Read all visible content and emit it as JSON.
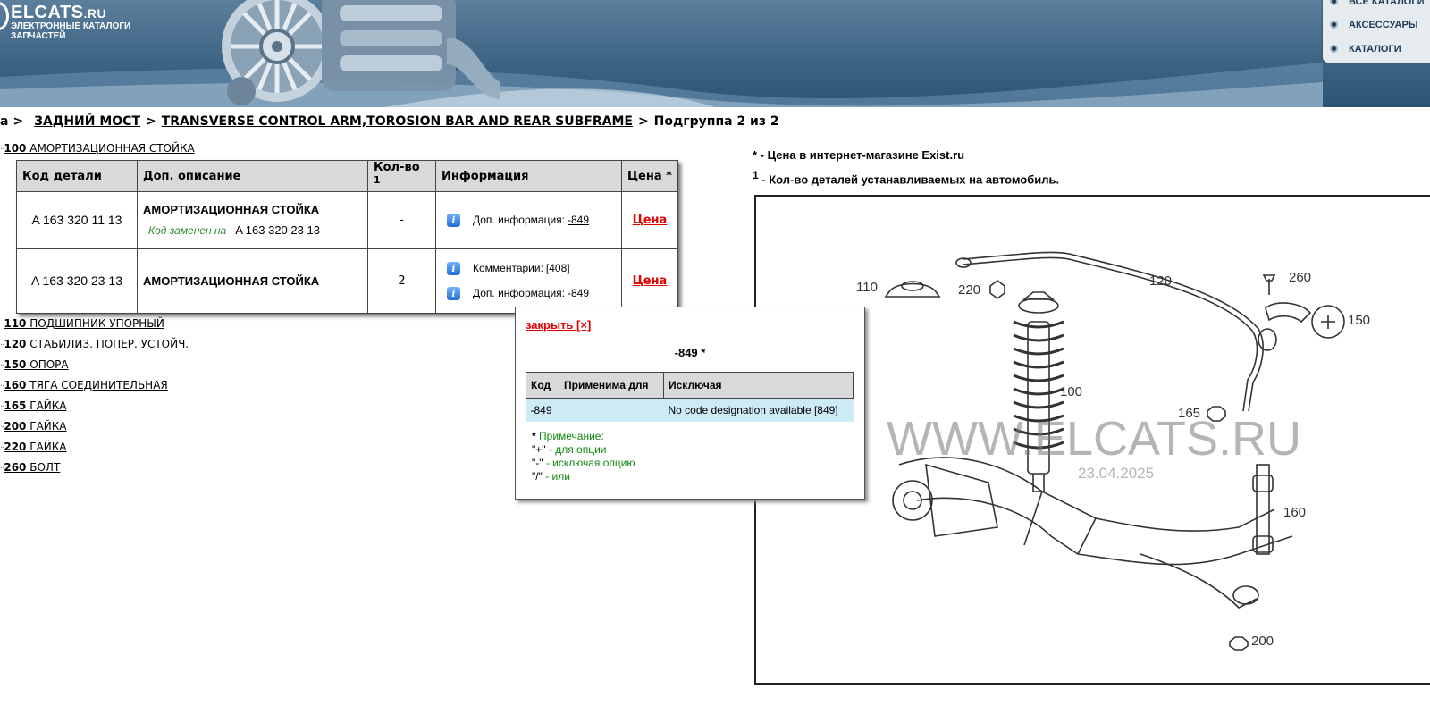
{
  "header": {
    "logo_title": "ELCATS",
    "logo_suffix": ".RU",
    "logo_subtitle": "ЭЛЕКТРОННЫЕ КАТАЛОГИ ЗАПЧАСТЕЙ",
    "top_nav": [
      "ВСЕ КАТАЛОГИ",
      "АКСЕССУАРЫ",
      "КАТАЛОГИ"
    ]
  },
  "breadcrumb": {
    "prefix": "a >",
    "items": [
      "ЗАДНИЙ МОСТ",
      "TRANSVERSE CONTROL ARM,TOROSION BAR AND REAR SUBFRAME"
    ],
    "current": "Подгруппа 2 из 2"
  },
  "subgroups": [
    {
      "num": "100",
      "name": "АМОРТИЗАЦИОННАЯ СТОЙКА"
    },
    {
      "num": "110",
      "name": "ПОДШИПНИК УПОРНЫЙ"
    },
    {
      "num": "120",
      "name": "СТАБИЛИЗ. ПОПЕР. УСТОЙЧ."
    },
    {
      "num": "150",
      "name": "ОПОРА"
    },
    {
      "num": "160",
      "name": "ТЯГА СОЕДИНИТЕЛЬНАЯ"
    },
    {
      "num": "165",
      "name": "ГАЙКА"
    },
    {
      "num": "200",
      "name": "ГАЙКА"
    },
    {
      "num": "220",
      "name": "ГАЙКА"
    },
    {
      "num": "260",
      "name": "БОЛТ"
    }
  ],
  "parts_table": {
    "headers": {
      "code": "Код детали",
      "desc": "Доп. описание",
      "qty": "Кол-во",
      "qty_sup": "1",
      "info": "Информация",
      "price": "Цена *"
    },
    "rows": [
      {
        "code": "A  163 320 11 13",
        "desc": "АМОРТИЗАЦИОННАЯ СТОЙКА",
        "replaced_label": "Код заменен на",
        "replaced_code": "A  163 320 23 13",
        "qty": "-",
        "info": [
          {
            "label": "Доп. информация:",
            "link": "-849"
          }
        ],
        "price": "Цена"
      },
      {
        "code": "A  163 320 23 13",
        "desc": "АМОРТИЗАЦИОННАЯ СТОЙКА",
        "qty": "2",
        "info": [
          {
            "label": "Комментарии:",
            "link": "[408]"
          },
          {
            "label": "Доп. информация:",
            "link": "-849"
          }
        ],
        "price": "Цена"
      }
    ]
  },
  "notes": {
    "price_note": "* - Цена в интернет-магазине Exist.ru",
    "qty_sup": "1",
    "qty_note": " - Кол-во деталей устанавливаемых на автомобиль."
  },
  "popup": {
    "close_label": "закрыть [×]",
    "title": "-849 *",
    "headers": [
      "Код",
      "Применима для",
      "Исключая"
    ],
    "row": {
      "code": "-849",
      "applies": "",
      "excluding": "No code designation available [849]"
    },
    "note_title": "Примечание:",
    "note_lines": [
      {
        "sym": "\"+\"",
        "text": " - для опции"
      },
      {
        "sym": "\"-\"",
        "text": " - исключая опцию"
      },
      {
        "sym": "\"/\"",
        "text": " - или"
      }
    ]
  },
  "diagram": {
    "callouts": [
      "110",
      "220",
      "120",
      "260",
      "150",
      "100",
      "165",
      "160",
      "200"
    ],
    "watermark": "WWW.ELCATS.RU",
    "watermark_date": "23.04.2025"
  }
}
